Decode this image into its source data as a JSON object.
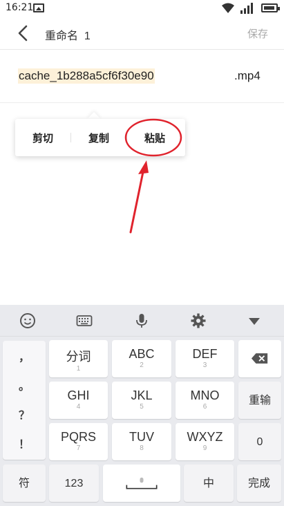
{
  "status_bar": {
    "time": "16:21"
  },
  "header": {
    "title": "重命名",
    "count": "1",
    "save_label": "保存"
  },
  "file": {
    "name": "cache_1b288a5cf6f30e90",
    "extension": ".mp4"
  },
  "context_menu": {
    "items": [
      "剪切",
      "复制",
      "粘贴"
    ]
  },
  "annotation": {
    "color": "#e0232d"
  },
  "keyboard": {
    "toolbar": [
      "emoji-icon",
      "keyboard-icon",
      "microphone-icon",
      "settings-icon",
      "collapse-icon"
    ],
    "punctuation": [
      "，",
      "。",
      "？",
      "！"
    ],
    "rows": [
      [
        {
          "main": "分词",
          "sub": "1"
        },
        {
          "main": "ABC",
          "sub": "2"
        },
        {
          "main": "DEF",
          "sub": "3"
        }
      ],
      [
        {
          "main": "GHI",
          "sub": "4"
        },
        {
          "main": "JKL",
          "sub": "5"
        },
        {
          "main": "MNO",
          "sub": "6"
        }
      ],
      [
        {
          "main": "PQRS",
          "sub": "7"
        },
        {
          "main": "TUV",
          "sub": "8"
        },
        {
          "main": "WXYZ",
          "sub": "9"
        }
      ]
    ],
    "right_keys": {
      "reenter": "重输",
      "zero": "0"
    },
    "bottom": {
      "symbols": "符",
      "numbers": "123",
      "lang": "中",
      "done": "完成"
    }
  }
}
